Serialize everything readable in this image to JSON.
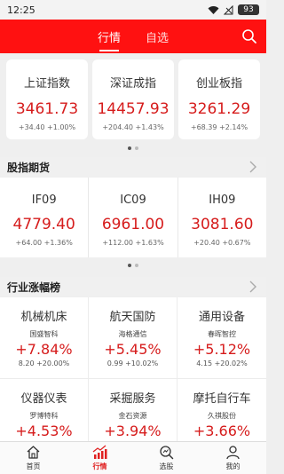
{
  "status_bar": {
    "time": "12:25",
    "battery": "93"
  },
  "top_nav": {
    "tabs": [
      "行情",
      "自选"
    ],
    "active": 0
  },
  "indices": [
    {
      "name": "上证指数",
      "price": "3461.73",
      "change": "+34.40  +1.00%"
    },
    {
      "name": "深证成指",
      "price": "14457.93",
      "change": "+204.40  +1.43%"
    },
    {
      "name": "创业板指",
      "price": "3261.29",
      "change": "+68.39  +2.14%"
    }
  ],
  "futures_section": {
    "title": "股指期货",
    "items": [
      {
        "name": "IF09",
        "price": "4779.40",
        "change": "+64.00  +1.36%"
      },
      {
        "name": "IC09",
        "price": "6961.00",
        "change": "+112.00  +1.63%"
      },
      {
        "name": "IH09",
        "price": "3081.60",
        "change": "+20.40  +0.67%"
      }
    ]
  },
  "sector_section": {
    "title": "行业涨幅榜",
    "items": [
      {
        "name": "机械机床",
        "lead": "国盛智科",
        "pct": "+7.84%",
        "sub": "8.20  +20.00%"
      },
      {
        "name": "航天国防",
        "lead": "海格通信",
        "pct": "+5.45%",
        "sub": "0.99  +10.02%"
      },
      {
        "name": "通用设备",
        "lead": "春晖智控",
        "pct": "+5.12%",
        "sub": "4.15  +20.02%"
      },
      {
        "name": "仪器仪表",
        "lead": "罗博特科",
        "pct": "+4.53%",
        "sub": ""
      },
      {
        "name": "采掘服务",
        "lead": "金石资源",
        "pct": "+3.94%",
        "sub": ""
      },
      {
        "name": "摩托自行车",
        "lead": "久祺股份",
        "pct": "+3.66%",
        "sub": ""
      }
    ]
  },
  "tab_bar": {
    "items": [
      {
        "label": "首页",
        "icon": "home-icon"
      },
      {
        "label": "行情",
        "icon": "chart-icon"
      },
      {
        "label": "选股",
        "icon": "stock-picker-icon"
      },
      {
        "label": "我的",
        "icon": "user-icon"
      }
    ],
    "active": 1
  },
  "colors": {
    "brand_red": "#ff1111",
    "price_red": "#d61c1c"
  }
}
